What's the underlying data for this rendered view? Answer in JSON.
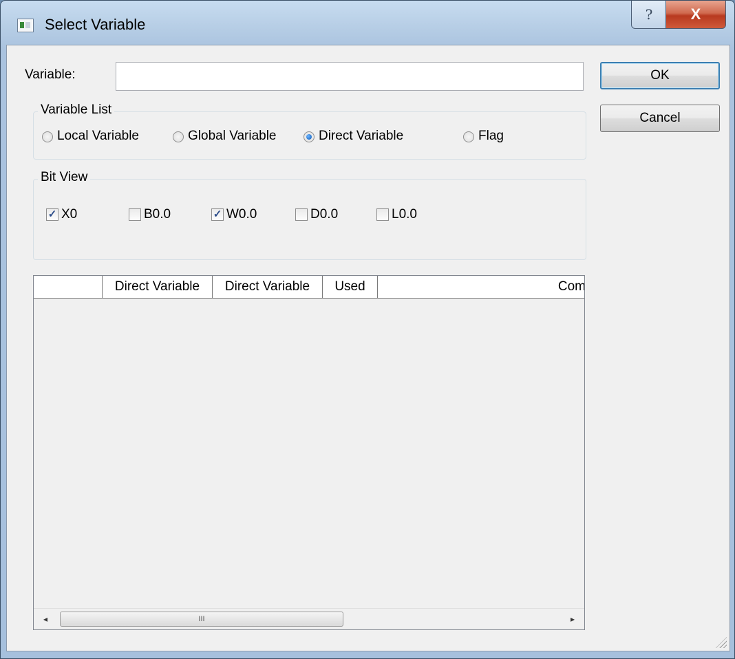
{
  "window": {
    "title": "Select Variable",
    "help_label": "?",
    "close_label": "X"
  },
  "form": {
    "variable_label": "Variable:",
    "variable_value": "",
    "ok_label": "OK",
    "cancel_label": "Cancel"
  },
  "variable_list": {
    "legend": "Variable List",
    "options": [
      {
        "label": "Local Variable",
        "selected": false
      },
      {
        "label": "Global Variable",
        "selected": false
      },
      {
        "label": "Direct Variable",
        "selected": true
      },
      {
        "label": "Flag",
        "selected": false
      }
    ]
  },
  "bit_view": {
    "legend": "Bit View",
    "options": [
      {
        "label": "X0",
        "checked": true
      },
      {
        "label": "B0.0",
        "checked": false
      },
      {
        "label": "W0.0",
        "checked": true
      },
      {
        "label": "D0.0",
        "checked": false
      },
      {
        "label": "L0.0",
        "checked": false
      }
    ]
  },
  "table": {
    "columns": [
      "",
      "Direct Variable",
      "Direct Variable",
      "Used",
      "Com"
    ],
    "rows": []
  },
  "scrollbar": {
    "left_arrow": "◂",
    "right_arrow": "▸",
    "thumb_grip": "III"
  }
}
